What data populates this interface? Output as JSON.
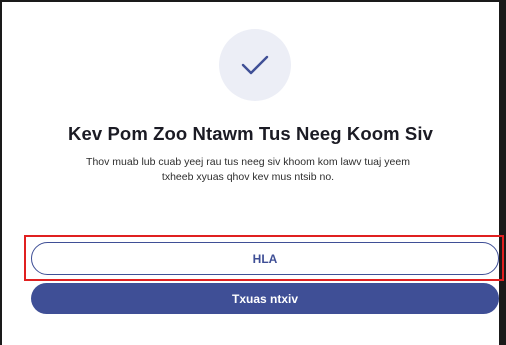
{
  "dialog": {
    "icon": "checkmark-icon",
    "title": "Kev Pom Zoo Ntawm Tus Neeg Koom Siv",
    "description": "Thov muab lub cuab yeej rau tus neeg siv khoom kom lawv tuaj yeem txheeb xyuas qhov kev mus ntsib no.",
    "primary_outline_label": "HLA",
    "secondary_filled_label": "Txuas ntxiv"
  },
  "colors": {
    "accent": "#3f4f96",
    "icon_bg": "#eceef6",
    "highlight": "#e02020"
  }
}
